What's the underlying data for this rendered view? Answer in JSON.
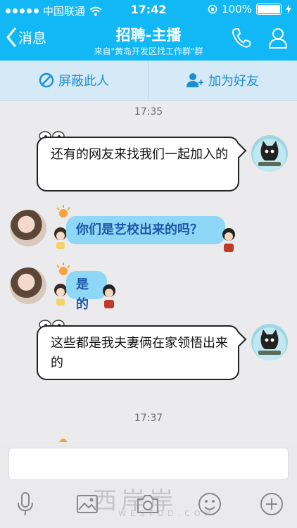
{
  "status": {
    "carrier": "中国联通",
    "time": "17:42",
    "battery": "100%"
  },
  "nav": {
    "back_label": "消息",
    "title": "招聘-主播",
    "subtitle": "来自\"黄岛开发区找工作群\"群"
  },
  "actions": {
    "block_label": "屏蔽此人",
    "add_friend_label": "加为好友"
  },
  "messages": [
    {
      "timestamp": "17:35"
    },
    {
      "text": "还有的网友来找我们一起加入的"
    },
    {
      "text": "你们是艺校出来的吗？"
    },
    {
      "text": "是的"
    },
    {
      "text": "这些都是我夫妻俩在家领悟出来的"
    },
    {
      "timestamp": "17:37"
    }
  ],
  "watermark": {
    "main": "西岸岸",
    "sub": "WESTOD.COM"
  },
  "colors": {
    "accent": "#12b7f5",
    "bubble_blue": "#8fd7f7"
  }
}
